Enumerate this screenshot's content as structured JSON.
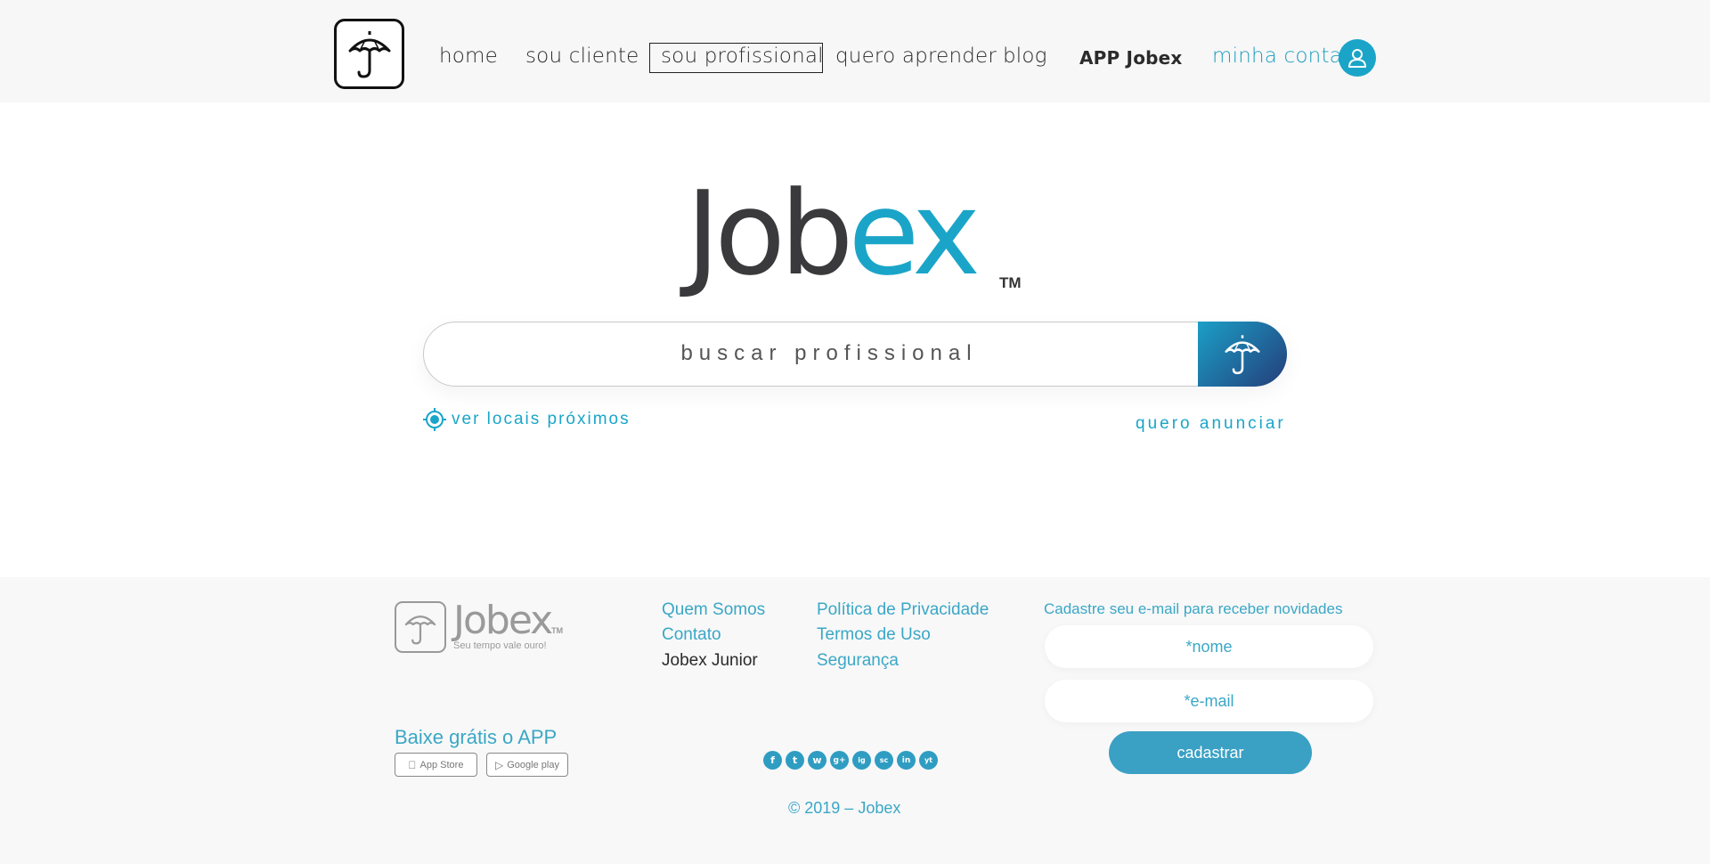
{
  "header": {
    "nav": [
      {
        "label": "home"
      },
      {
        "label": "sou cliente"
      },
      {
        "label": "sou profissional"
      },
      {
        "label": "quero aprender"
      },
      {
        "label": "blog"
      },
      {
        "label": "APP  Jobex"
      },
      {
        "label": "minha  conta"
      }
    ],
    "active": "sou profissional"
  },
  "hero": {
    "brand_part1": "Job",
    "brand_part2": "ex",
    "tm": "TM",
    "search_placeholder": "buscar profissional",
    "near_label": "ver locais próximos",
    "advertise_label": "quero anunciar"
  },
  "footer": {
    "logo_name": "Jobex",
    "logo_tm": "TM",
    "tagline": "Seu tempo vale ouro!",
    "links_col1": [
      "Quem Somos",
      "Contato",
      "Jobex Junior"
    ],
    "links_col2": [
      "Política de Privacidade",
      "Termos de Uso",
      "Segurança"
    ],
    "newsletter": {
      "title": "Cadastre seu e-mail para receber novidades",
      "name_placeholder": "*nome",
      "email_placeholder": "*e-mail",
      "button": "cadastrar"
    },
    "app_title": "Baixe grátis o APP",
    "app_store": "App Store",
    "google_play": "Google play",
    "socials": [
      "f",
      "t",
      "w",
      "g+",
      "ig",
      "sc",
      "in",
      "yt"
    ],
    "copyright": "© 2019 – Jobex"
  },
  "colors": {
    "accent": "#1aa5c8",
    "dark": "#3a3a3c",
    "button_gradient_end": "#243d7a"
  }
}
